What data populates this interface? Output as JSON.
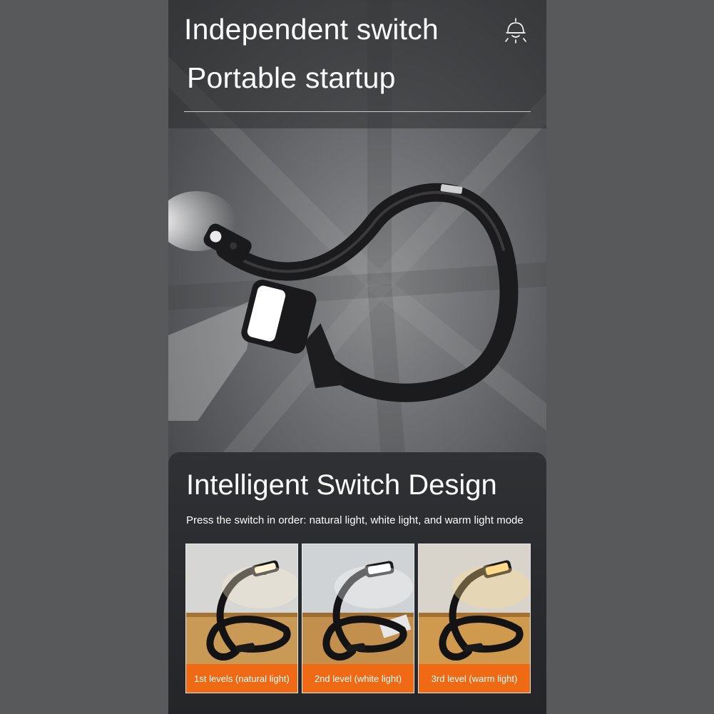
{
  "hero": {
    "title_line1": "Independent switch",
    "title_line2": "Portable startup",
    "icon": "lamp-icon"
  },
  "section": {
    "title": "Intelligent Switch Design",
    "description": "Press the switch in order: natural light, white light, and warm light mode"
  },
  "modes": [
    {
      "label": "1st levels (natural light)",
      "light_color": "#fff2d6"
    },
    {
      "label": "2nd level (white light)",
      "light_color": "#ffffff"
    },
    {
      "label": "3rd level (warm light)",
      "light_color": "#ffd98a"
    }
  ],
  "colors": {
    "accent": "#f06a16",
    "page_background": "#58595b",
    "panel_dark": "#2a2b2e"
  }
}
